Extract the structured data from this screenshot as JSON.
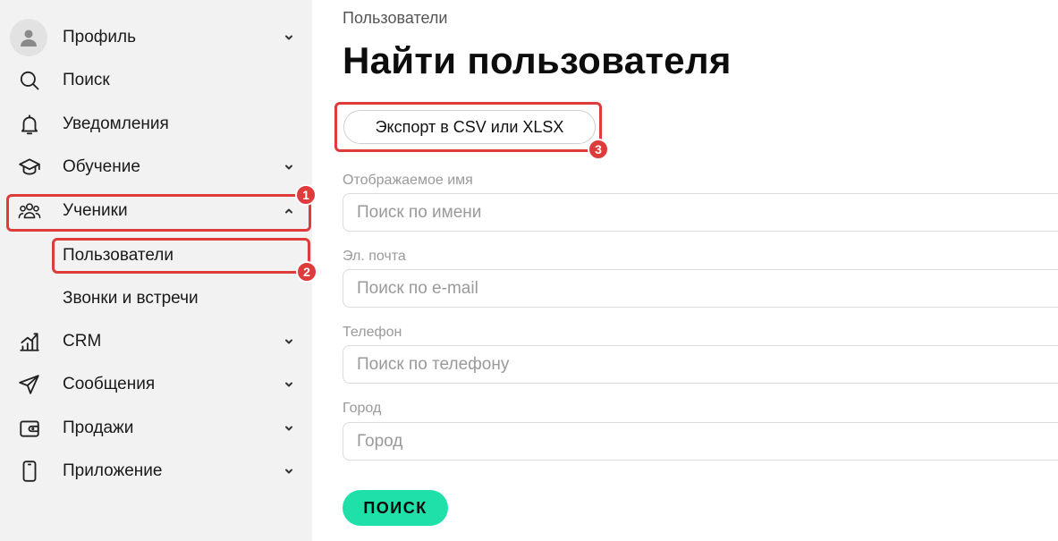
{
  "sidebar": {
    "items": [
      {
        "label": "Профиль",
        "icon": "user-icon",
        "has_chevron": true,
        "chevron": "down"
      },
      {
        "label": "Поиск",
        "icon": "search-icon",
        "has_chevron": false
      },
      {
        "label": "Уведомления",
        "icon": "bell-icon",
        "has_chevron": false
      },
      {
        "label": "Обучение",
        "icon": "graduation-cap-icon",
        "has_chevron": true,
        "chevron": "down"
      },
      {
        "label": "Ученики",
        "icon": "users-icon",
        "has_chevron": true,
        "chevron": "up"
      },
      {
        "label": "CRM",
        "icon": "bar-chart-icon",
        "has_chevron": true,
        "chevron": "down"
      },
      {
        "label": "Сообщения",
        "icon": "send-icon",
        "has_chevron": true,
        "chevron": "down"
      },
      {
        "label": "Продажи",
        "icon": "wallet-icon",
        "has_chevron": true,
        "chevron": "down"
      },
      {
        "label": "Приложение",
        "icon": "smartphone-icon",
        "has_chevron": true,
        "chevron": "down"
      }
    ],
    "subitems": [
      {
        "label": "Пользователи"
      },
      {
        "label": "Звонки и встречи"
      }
    ]
  },
  "annotations": {
    "badge1": "1",
    "badge2": "2",
    "badge3": "3",
    "color": "#e03b3b"
  },
  "main": {
    "breadcrumb": "Пользователи",
    "title": "Найти пользователя",
    "export_label": "Экспорт в CSV или XLSX",
    "fields": [
      {
        "label": "Отображаемое имя",
        "placeholder": "Поиск по имени"
      },
      {
        "label": "Эл. почта",
        "placeholder": "Поиск по e-mail"
      },
      {
        "label": "Телефон",
        "placeholder": "Поиск по телефону"
      },
      {
        "label": "Город",
        "placeholder": "Город"
      }
    ],
    "search_label": "ПОИСК",
    "accent_color": "#1fe0a8"
  }
}
